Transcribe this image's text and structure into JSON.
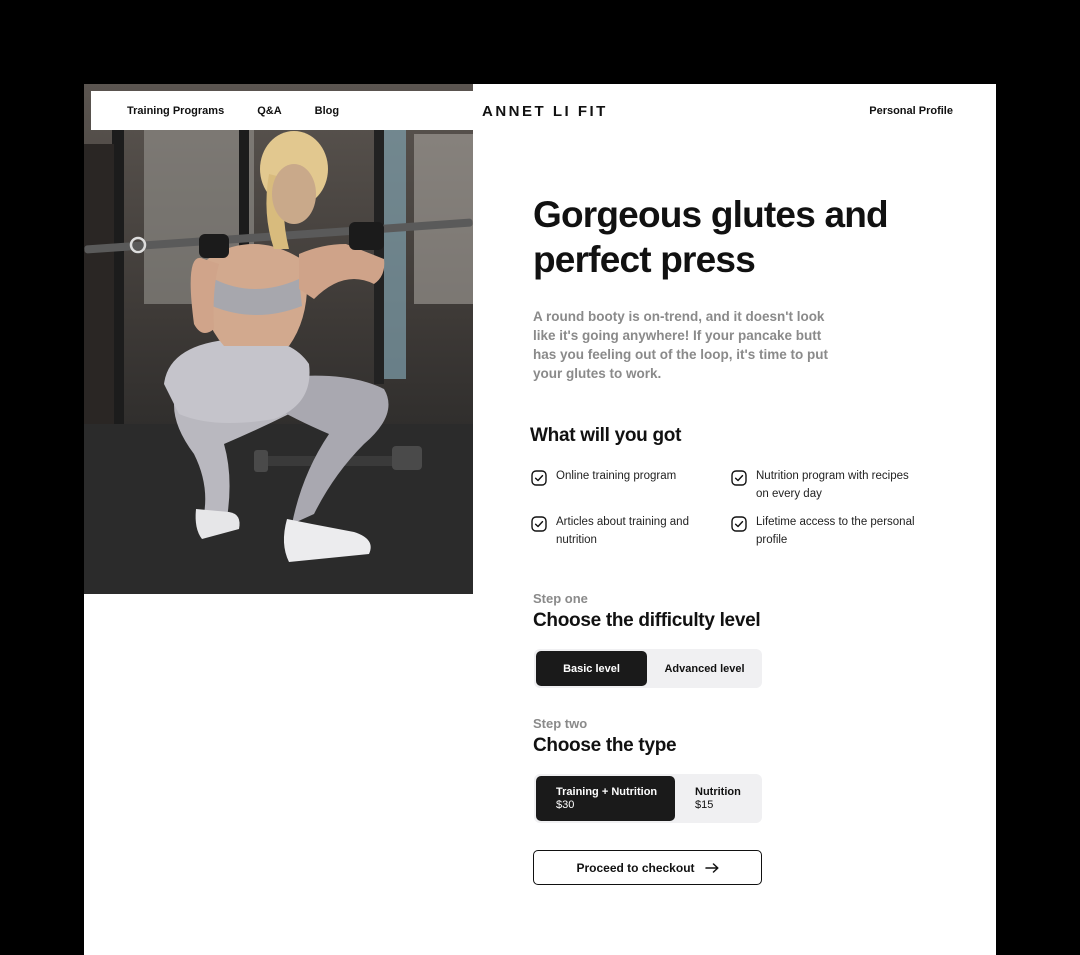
{
  "nav": {
    "links": [
      "Training Programs",
      "Q&A",
      "Blog"
    ],
    "logo": "ANNET LI FIT",
    "profile": "Personal Profile"
  },
  "hero": {
    "image_alt": "Woman squatting with barbell in gym"
  },
  "main": {
    "title": "Gorgeous glutes and perfect press",
    "description": "A round booty is on-trend, and it doesn't look like it's going anywhere! If your pancake butt has you feeling out of the loop, it's time to put your glutes to work."
  },
  "features": {
    "title": "What will you got",
    "items": [
      "Online training program",
      "Nutrition program with recipes on every day",
      "Articles about training and nutrition",
      "Lifetime access to the personal profile"
    ],
    "icon": "check-circle-icon"
  },
  "step_one": {
    "label": "Step one",
    "title": "Choose the difficulty level",
    "options": [
      "Basic level",
      "Advanced level"
    ],
    "selected": "Basic level"
  },
  "step_two": {
    "label": "Step two",
    "title": "Choose the type",
    "options": [
      {
        "name": "Training + Nutrition",
        "price": "$30"
      },
      {
        "name": "Nutrition",
        "price": "$15"
      }
    ],
    "selected": "Training + Nutrition"
  },
  "checkout": {
    "label": "Proceed to checkout",
    "icon": "arrow-right-icon"
  },
  "colors": {
    "background": "#000000",
    "page": "#ffffff",
    "accent_dark": "#1a1a1a",
    "muted_text": "#8a8a8a",
    "segment_bg": "#f0f0f2"
  }
}
